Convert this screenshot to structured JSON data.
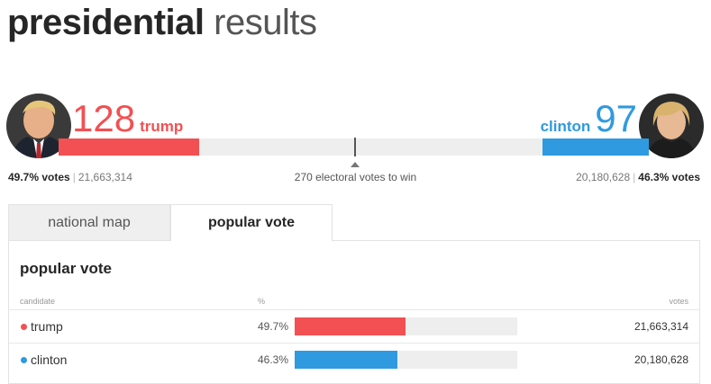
{
  "header": {
    "title_bold": "presidential",
    "title_light": "results"
  },
  "colors": {
    "trump": "#f25052",
    "clinton": "#2f9ae0",
    "track": "#eeeeee"
  },
  "electoral": {
    "trump": {
      "votes": "128",
      "name": "trump",
      "ev_fraction": 0.238
    },
    "clinton": {
      "votes": "97",
      "name": "clinton",
      "ev_fraction": 0.18
    },
    "to_win_label": "270 electoral votes to win"
  },
  "popular_summary": {
    "trump": {
      "pct": "49.7% votes",
      "count": "21,663,314"
    },
    "clinton": {
      "pct": "46.3% votes",
      "count": "20,180,628"
    }
  },
  "tabs": [
    {
      "label": "national map",
      "active": false
    },
    {
      "label": "popular vote",
      "active": true
    }
  ],
  "panel": {
    "title": "popular vote",
    "columns": {
      "candidate": "candidate",
      "pct": "%",
      "votes": "votes"
    },
    "rows": [
      {
        "name": "trump",
        "pct": "49.7%",
        "pct_value": 0.497,
        "votes": "21,663,314",
        "color": "#f25052"
      },
      {
        "name": "clinton",
        "pct": "46.3%",
        "pct_value": 0.463,
        "votes": "20,180,628",
        "color": "#2f9ae0"
      }
    ]
  }
}
